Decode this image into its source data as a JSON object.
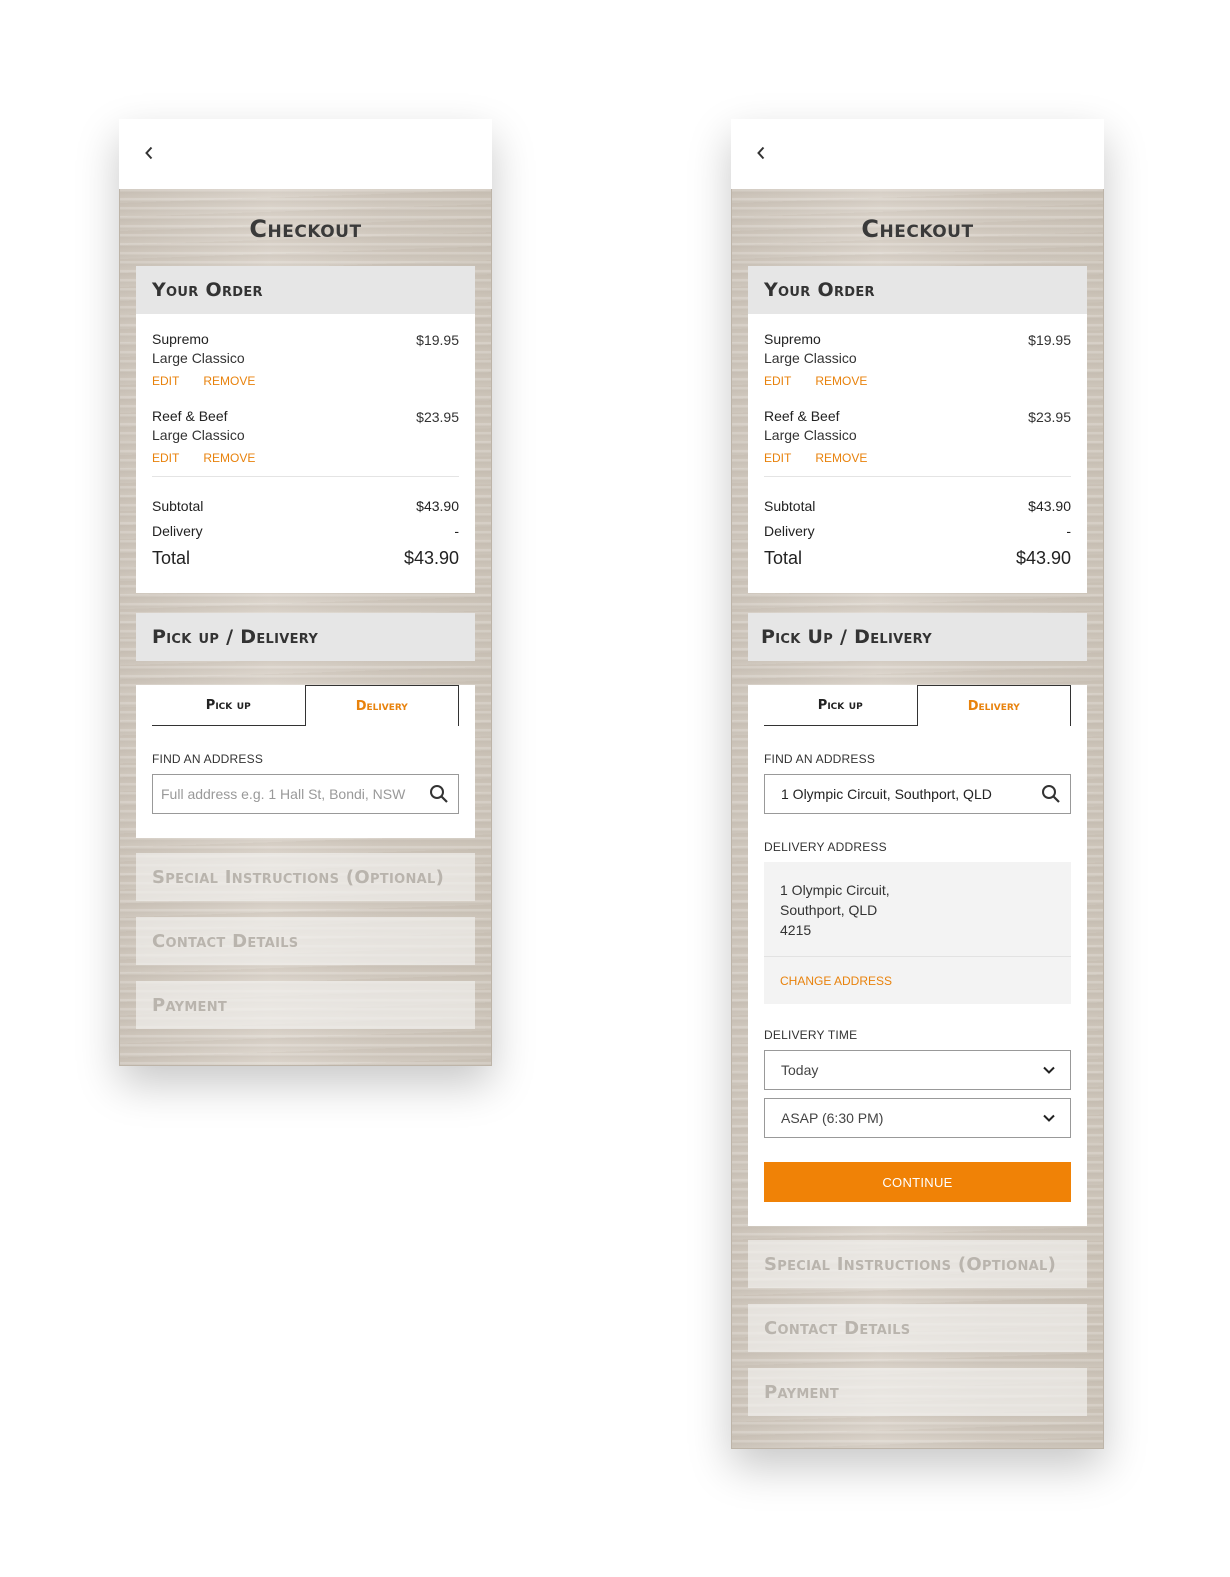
{
  "screens": {
    "left": {
      "page_title": "Checkout",
      "order": {
        "heading": "Your Order",
        "items": [
          {
            "name": "Supremo",
            "size": "Large Classico",
            "price": "$19.95",
            "edit": "EDIT",
            "remove": "REMOVE"
          },
          {
            "name": "Reef & Beef",
            "size": "Large Classico",
            "price": "$23.95",
            "edit": "EDIT",
            "remove": "REMOVE"
          }
        ],
        "subtotal_label": "Subtotal",
        "subtotal_value": "$43.90",
        "delivery_label": "Delivery",
        "delivery_value": "-",
        "total_label": "Total",
        "total_value": "$43.90"
      },
      "pickup_delivery": {
        "heading": "Pick up / Delivery",
        "tab_pickup": "Pick up",
        "tab_delivery": "Delivery",
        "find_label": "FIND AN ADDRESS",
        "search_value": "",
        "search_placeholder": "Full address e.g. 1 Hall St, Bondi, NSW"
      },
      "collapsed_sections": [
        "Special Instructions (Optional)",
        "Contact Details",
        "Payment"
      ]
    },
    "right": {
      "page_title": "Checkout",
      "order": {
        "heading": "Your Order",
        "items": [
          {
            "name": "Supremo",
            "size": "Large Classico",
            "price": "$19.95",
            "edit": "EDIT",
            "remove": "REMOVE"
          },
          {
            "name": "Reef & Beef",
            "size": "Large Classico",
            "price": "$23.95",
            "edit": "EDIT",
            "remove": "REMOVE"
          }
        ],
        "subtotal_label": "Subtotal",
        "subtotal_value": "$43.90",
        "delivery_label": "Delivery",
        "delivery_value": "-",
        "total_label": "Total",
        "total_value": "$43.90"
      },
      "pickup_delivery": {
        "heading": "Pick Up / Delivery",
        "tab_pickup": "Pick up",
        "tab_delivery": "Delivery",
        "find_label": "FIND AN ADDRESS",
        "search_value": "1 Olympic Circuit, Southport, QLD",
        "delivery_address_label": "DELIVERY ADDRESS",
        "address_lines": [
          "1 Olympic Circuit,",
          "Southport, QLD",
          "4215"
        ],
        "change_address": "CHANGE ADDRESS",
        "delivery_time_label": "DELIVERY TIME",
        "day_selected": "Today",
        "time_selected": "ASAP (6:30 PM)",
        "continue_label": "CONTINUE"
      },
      "collapsed_sections": [
        "Special Instructions (Optional)",
        "Contact Details",
        "Payment"
      ]
    }
  },
  "icons": {
    "back": "chevron-left-icon",
    "search": "search-icon",
    "dropdown": "chevron-down-icon"
  },
  "colors": {
    "accent": "#e8820c",
    "button": "#f08206",
    "section_header": "#e6e6e6"
  }
}
